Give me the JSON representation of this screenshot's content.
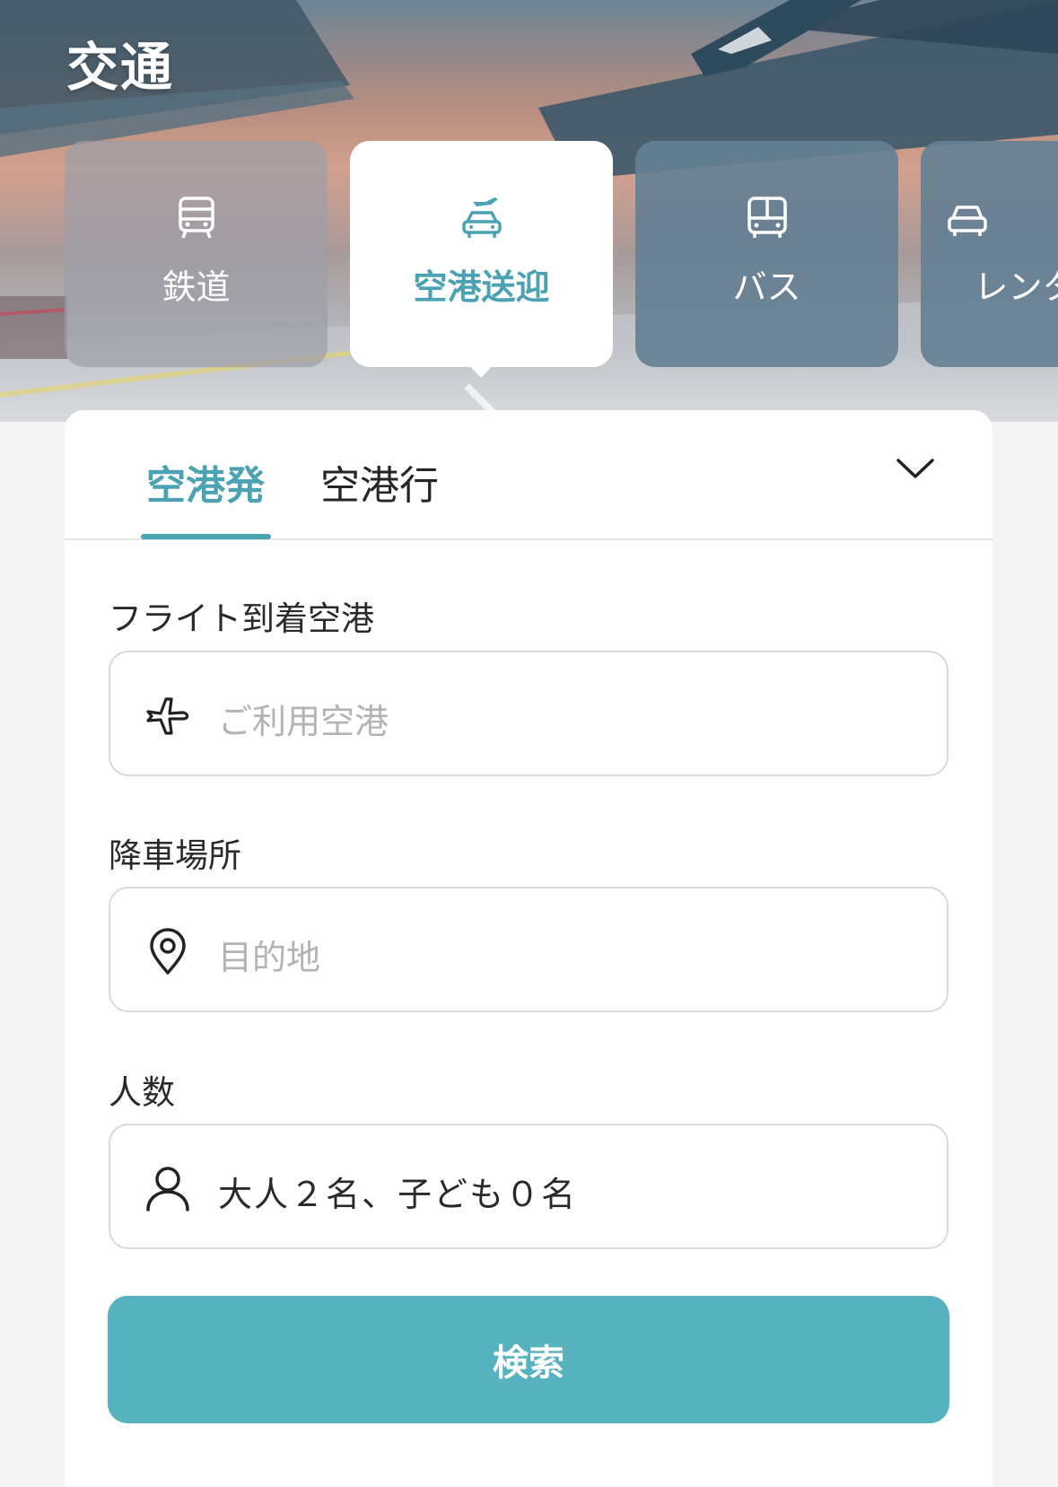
{
  "header": {
    "title": "交通"
  },
  "categories": [
    {
      "label": "鉄道",
      "icon": "train-icon"
    },
    {
      "label": "空港送迎",
      "icon": "airport-transfer-icon"
    },
    {
      "label": "バス",
      "icon": "bus-icon"
    },
    {
      "label": "レンタ",
      "icon": "rental-car-icon"
    }
  ],
  "active_category": "空港送迎",
  "direction_tabs": {
    "from_airport": "空港発",
    "to_airport": "空港行",
    "active": "空港発"
  },
  "form": {
    "airport": {
      "label": "フライト到着空港",
      "placeholder": "ご利用空港",
      "icon": "airplane-icon"
    },
    "dropoff": {
      "label": "降車場所",
      "placeholder": "目的地",
      "icon": "location-pin-icon"
    },
    "passengers": {
      "label": "人数",
      "value": "大人２名、子ども０名",
      "icon": "person-icon"
    },
    "search_label": "検索"
  },
  "colors": {
    "accent": "#4aa2b3",
    "button": "#57b2c0"
  }
}
